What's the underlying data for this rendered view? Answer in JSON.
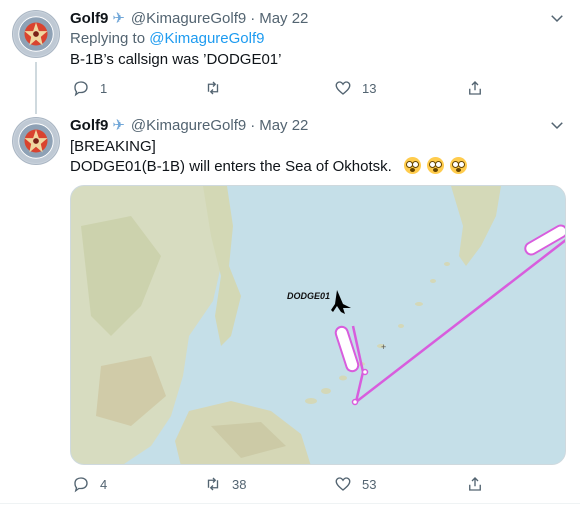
{
  "tweets": [
    {
      "author": {
        "name": "Golf9",
        "badge_icon": "airplane-icon",
        "handle": "@KimagureGolf9",
        "date": "May 22"
      },
      "replying_to": {
        "prefix": "Replying to",
        "mention": "@KimagureGolf9"
      },
      "text": "B-1B’s callsign was ’DODGE01’",
      "stats": {
        "replies": "1",
        "retweets": "",
        "likes": "13"
      }
    },
    {
      "author": {
        "name": "Golf9",
        "badge_icon": "airplane-icon",
        "handle": "@KimagureGolf9",
        "date": "May 22"
      },
      "text_line1": "[BREAKING]",
      "text_line2": "DODGE01(B-1B) will enters the Sea of Okhotsk.",
      "emoji": [
        "flushed-face",
        "flushed-face",
        "flushed-face"
      ],
      "media": {
        "type": "flight-track-map",
        "aircraft_label": "DODGE01",
        "track_color": "#d85ddd"
      },
      "stats": {
        "replies": "4",
        "retweets": "38",
        "likes": "53"
      }
    }
  ],
  "icons": {
    "reply": "reply-icon",
    "retweet": "retweet-icon",
    "like": "heart-icon",
    "share": "share-icon",
    "more": "chevron-down-icon"
  },
  "colors": {
    "link": "#1d9bf0",
    "secondary_text": "#536471",
    "sea": "#c5dfe8",
    "land": "#d9dcc2"
  }
}
